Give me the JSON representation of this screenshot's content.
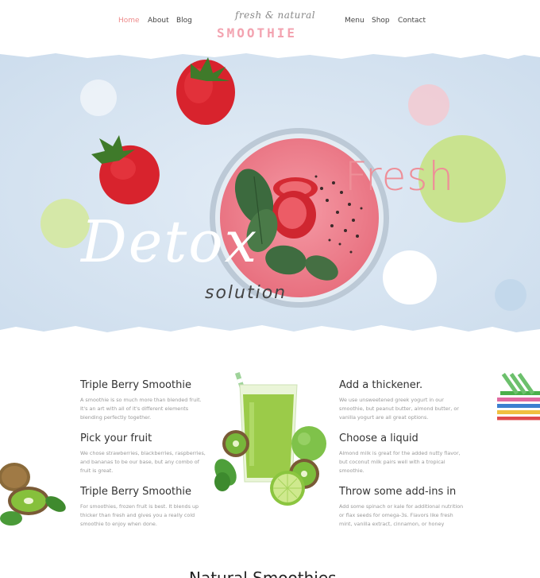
{
  "nav": {
    "left": [
      "Home",
      "About",
      "Blog"
    ],
    "right": [
      "Menu",
      "Shop",
      "Contact"
    ]
  },
  "logo": {
    "sub": "fresh & natural",
    "main": "SMOOTHIE"
  },
  "hero": {
    "fresh": "Fresh",
    "detox": "Detox",
    "solution": "solution"
  },
  "left_column": [
    {
      "title": "Triple Berry Smoothie",
      "text": "A smoothie is so much more than blended fruit. It's an art with all of it's different elements blending perfectly together."
    },
    {
      "title": "Pick your fruit",
      "text": "We chose strawberries, blackberries, raspberries, and bananas to be our base, but any combo of fruit is great."
    },
    {
      "title": "Triple Berry Smoothie",
      "text": "For smoothies, frozen fruit is best. It blends up thicker than fresh and gives you a really cold smoothie to enjoy when done."
    }
  ],
  "right_column": [
    {
      "title": "Add a thickener.",
      "text": "We use unsweetened greek yogurt in our smoothie, but peanut butter, almond butter, or vanilla yogurt are all great options."
    },
    {
      "title": "Choose a liquid",
      "text": "Almond milk is great for the added nutty flavor, but coconut milk pairs well with a tropical smoothie."
    },
    {
      "title": "Throw some add-ins in",
      "text": "Add some spinach or kale for additional nutrition or flax seeds for omega-3s. Flavors like fresh mint, vanilla extract, cinnamon, or honey"
    }
  ],
  "bottom_title": "Natural Smoothies",
  "colors": {
    "accent_pink": "#ee8a8a",
    "logo_pink": "#f3a3b0",
    "green_dot": "#c9e38f",
    "hero_bg": "#d4e3f0"
  }
}
